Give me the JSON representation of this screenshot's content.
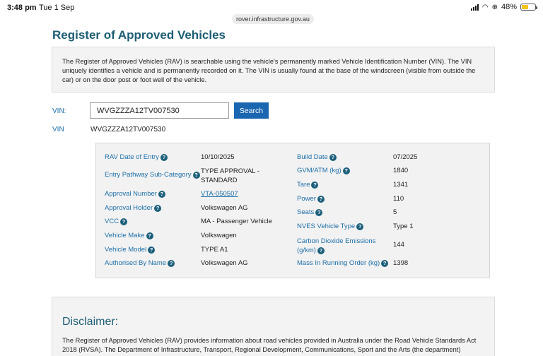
{
  "status_bar": {
    "time": "3:48 pm",
    "date": "Tue 1 Sep",
    "battery": "48%",
    "battery_level": 0.48
  },
  "browser": {
    "url": "rover.infrastructure.gov.au"
  },
  "page": {
    "title": "Register of Approved Vehicles",
    "intro": "The Register of Approved Vehicles (RAV) is searchable using the vehicle's permanently marked Vehicle Identification Number (VIN). The VIN uniquely identifies a vehicle and is permanently recorded on it. The VIN is usually found at the base of the windscreen (visible from outside the car) or on the door post or foot well of the vehicle."
  },
  "search": {
    "vin_label": "VIN:",
    "vin_value": "WVGZZZA12TV007530",
    "button_label": "Search",
    "result_label": "VIN",
    "result_value": "WVGZZZA12TV007530"
  },
  "details": {
    "left": [
      {
        "label": "RAV Date of Entry",
        "value": "10/10/2025"
      },
      {
        "label": "Entry Pathway Sub-Category",
        "value": "TYPE APPROVAL - STANDARD"
      },
      {
        "label": "Approval Number",
        "value": "VTA-050507"
      },
      {
        "label": "Approval Holder",
        "value": "Volkswagen AG"
      },
      {
        "label": "VCC",
        "value": "MA - Passenger Vehicle"
      },
      {
        "label": "Vehicle Make",
        "value": "Volkswagen"
      },
      {
        "label": "Vehicle Model",
        "value": "TYPE A1"
      },
      {
        "label": "Authorised By Name",
        "value": "Volkswagen AG"
      }
    ],
    "right": [
      {
        "label": "Build Date",
        "value": "07/2025"
      },
      {
        "label": "GVM/ATM (kg)",
        "value": "1840"
      },
      {
        "label": "Tare",
        "value": "1341"
      },
      {
        "label": "Power",
        "value": "110"
      },
      {
        "label": "Seats",
        "value": "5"
      },
      {
        "label": "NVES Vehicle Type",
        "value": "Type 1"
      },
      {
        "label": "Carbon Dioxide Emissions (g/km)",
        "value": "144"
      },
      {
        "label": "Mass In Running Order (kg)",
        "value": "1398"
      }
    ]
  },
  "disclaimer": {
    "title": "Disclaimer:",
    "text": "The Register of Approved Vehicles (RAV) provides information about road vehicles provided in Australia under the Road Vehicle Standards Act 2018 (RVSA). The Department of Infrastructure, Transport, Regional Development, Communications, Sport and the Arts (the department) maintains the RAV for public use but does not accept any liability for the timeliness and/or accuracy of results, nor the availability of the"
  },
  "icons": {
    "help": "question-circle-icon",
    "signal": "cellular-signal-icon",
    "wifi": "wifi-icon",
    "battery": "battery-icon"
  },
  "colors": {
    "title": "#1d5d74",
    "label": "#1d6fa8",
    "button": "#1b66b0",
    "panel_bg": "#f3f3f3"
  }
}
